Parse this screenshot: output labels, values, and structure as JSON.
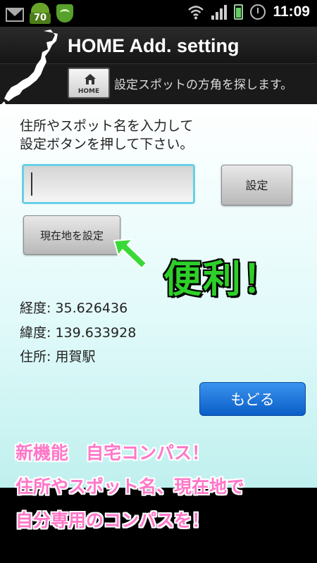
{
  "status_bar": {
    "badge_number": "70",
    "time": "11:09",
    "icons": [
      "mail-icon",
      "android-badge-icon",
      "shield-icon",
      "wifi-icon",
      "signal-icon",
      "battery-icon",
      "alarm-icon"
    ]
  },
  "app": {
    "title": "HOME Add. setting",
    "home_button_label": "HOME",
    "subtitle": "設定スポットの方角を探します。"
  },
  "form": {
    "instruction_line1": "住所やスポット名を入力して",
    "instruction_line2": "設定ボタンを押して下さい。",
    "address_value": "",
    "set_button": "設定",
    "current_location_button": "現在地を設定"
  },
  "callout": {
    "text": "便利！"
  },
  "info": {
    "latitude_label": "経度: ",
    "latitude_value": "35.626436",
    "longitude_label": "緯度: ",
    "longitude_value": "139.633928",
    "address_label": "住所: ",
    "address_value": "用賀駅"
  },
  "back_button": "もどる",
  "promo": {
    "line1": "新機能　自宅コンパス！",
    "line2": "住所やスポット名、現在地で",
    "line3": "自分専用のコンパスを！"
  },
  "colors": {
    "accent_cyan": "#67d0e6",
    "back_button_blue": "#0a5ec7",
    "callout_green": "#2ecf2a",
    "promo_pink": "#ff77c8"
  }
}
